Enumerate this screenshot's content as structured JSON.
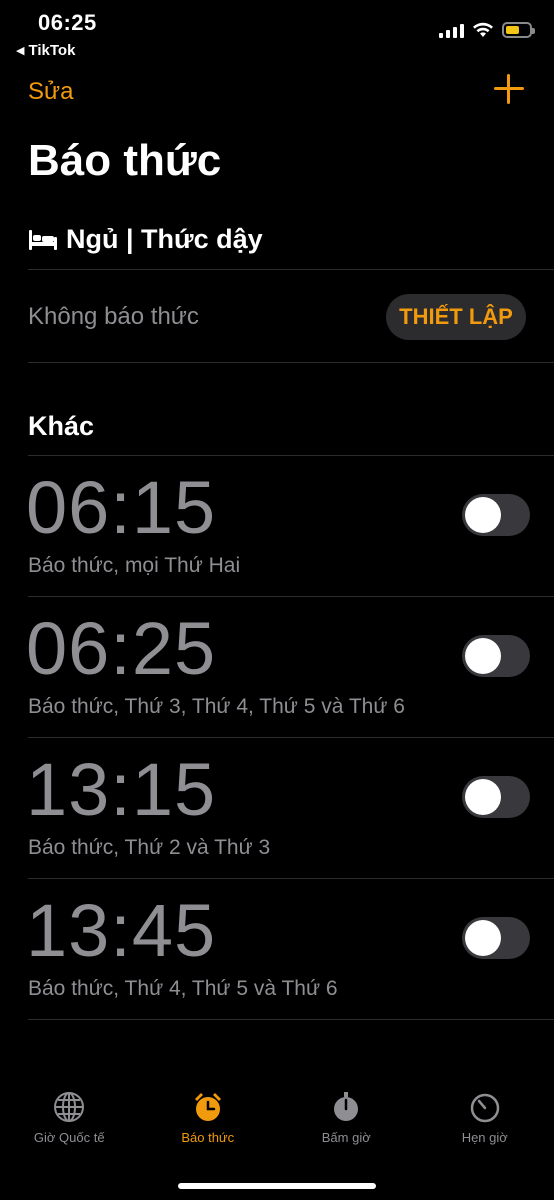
{
  "status_bar": {
    "time": "06:25",
    "back_app": "TikTok",
    "battery_level": 0.6,
    "colors": {
      "battery": "#f5c518"
    }
  },
  "nav": {
    "edit_label": "Sửa",
    "add_icon": "plus-icon"
  },
  "title": "Báo thức",
  "sleep": {
    "icon": "bed-icon",
    "header": "Ngủ | Thức dậy",
    "no_alarm_text": "Không báo thức",
    "setup_label": "THIẾT LẬP"
  },
  "other": {
    "header": "Khác",
    "alarms": [
      {
        "time": "06:15",
        "label": "Báo thức, mọi Thứ Hai",
        "enabled": false
      },
      {
        "time": "06:25",
        "label": "Báo thức, Thứ 3, Thứ 4, Thứ 5 và Thứ 6",
        "enabled": false
      },
      {
        "time": "13:15",
        "label": "Báo thức, Thứ 2 và Thứ 3",
        "enabled": false
      },
      {
        "time": "13:45",
        "label": "Báo thức, Thứ 4, Thứ 5 và Thứ 6",
        "enabled": false
      }
    ]
  },
  "tabs": [
    {
      "label": "Giờ Quốc tế",
      "icon": "globe-icon",
      "active": false
    },
    {
      "label": "Báo thức",
      "icon": "alarm-clock-icon",
      "active": true
    },
    {
      "label": "Bấm giờ",
      "icon": "stopwatch-icon",
      "active": false
    },
    {
      "label": "Hẹn giờ",
      "icon": "timer-icon",
      "active": false
    }
  ],
  "colors": {
    "accent": "#f19a0e",
    "secondary_text": "#8e8e93",
    "background": "#000000"
  }
}
